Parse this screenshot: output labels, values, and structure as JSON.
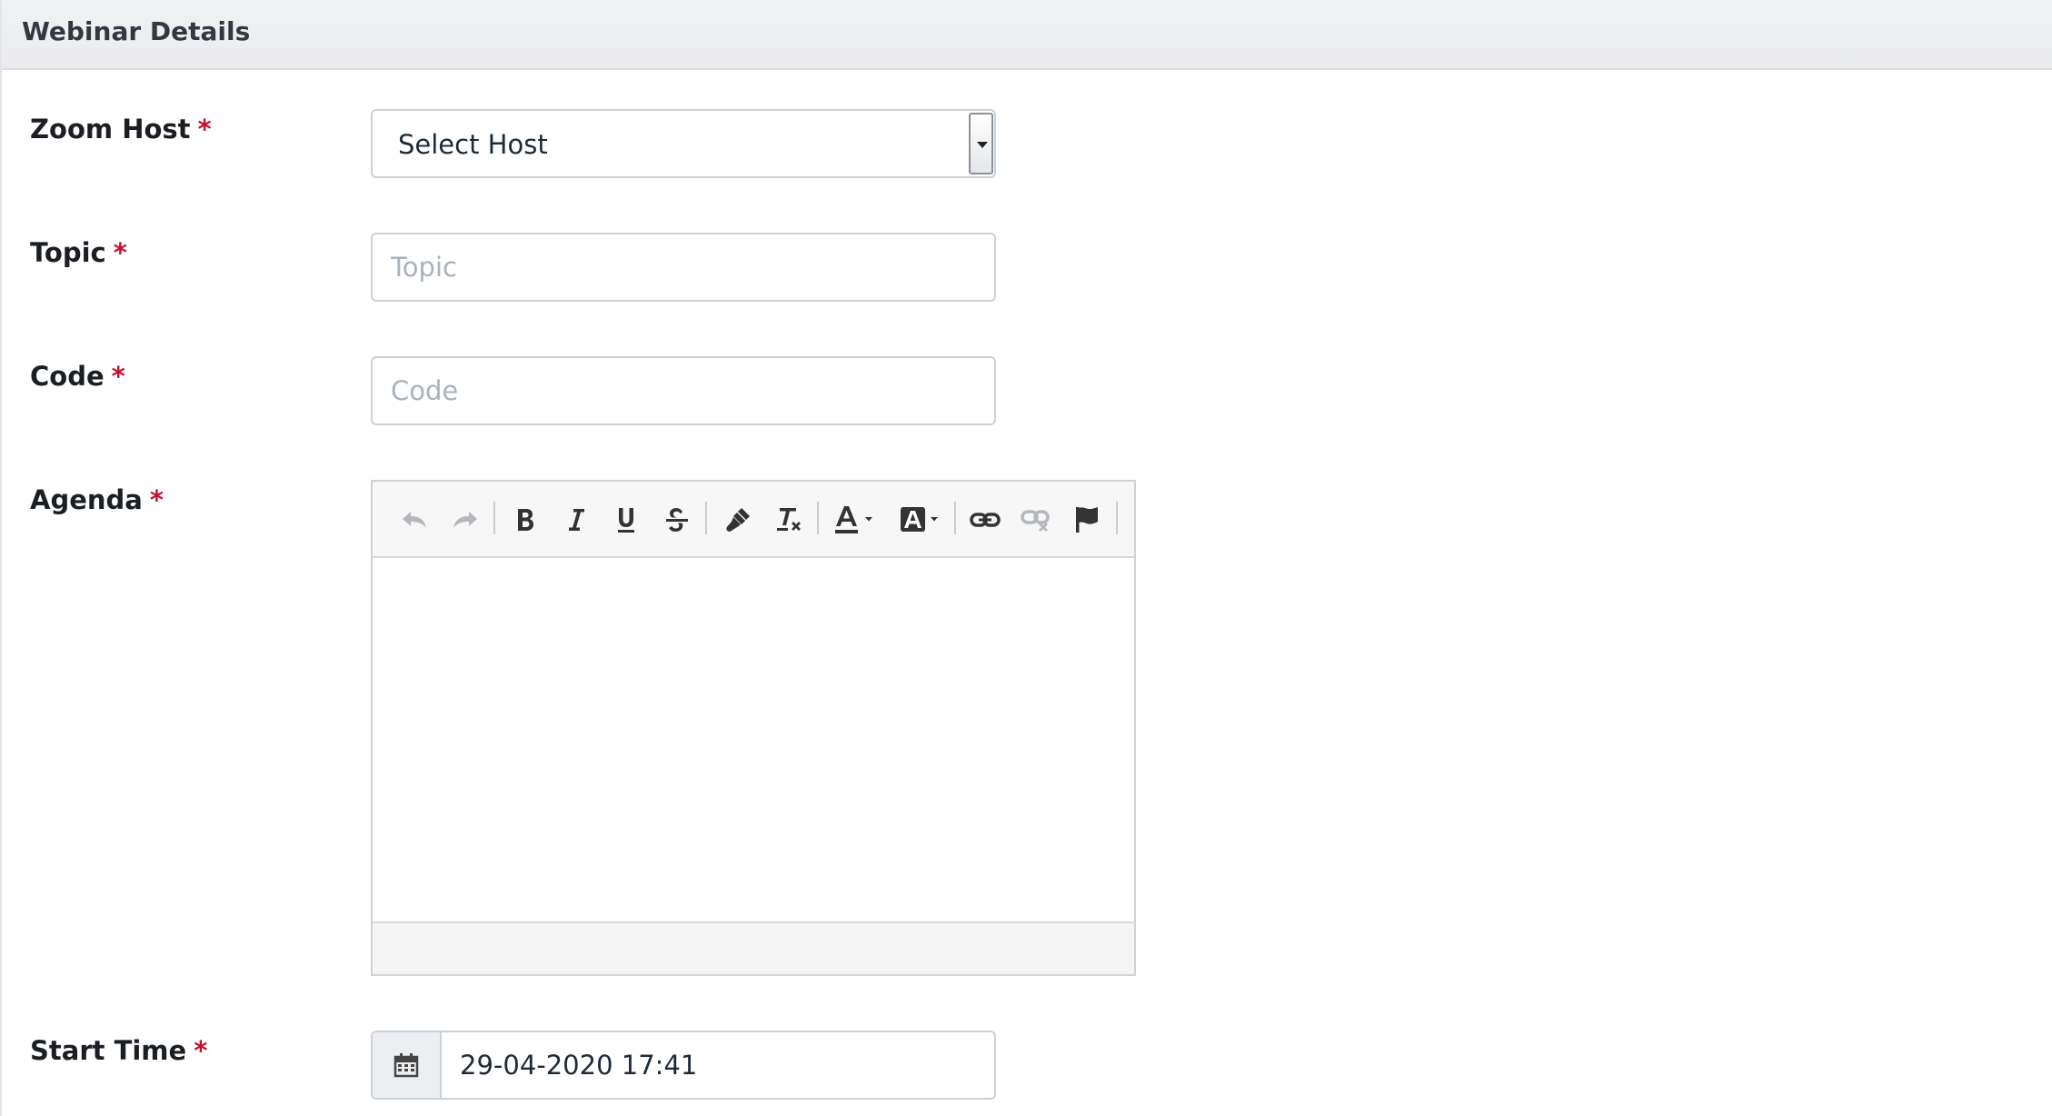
{
  "panel": {
    "title": "Webinar Details"
  },
  "form": {
    "required_marker": "*",
    "zoom_host": {
      "label": "Zoom Host",
      "selected": "Select Host"
    },
    "topic": {
      "label": "Topic",
      "placeholder": "Topic",
      "value": ""
    },
    "code": {
      "label": "Code",
      "placeholder": "Code",
      "value": ""
    },
    "agenda": {
      "label": "Agenda",
      "toolbar": [
        "undo-icon",
        "redo-icon",
        "bold-icon",
        "italic-icon",
        "underline-icon",
        "strikethrough-icon",
        "format-painter-icon",
        "clear-formatting-icon",
        "text-color-icon",
        "background-color-icon",
        "link-icon",
        "unlink-icon",
        "anchor-flag-icon"
      ]
    },
    "start_time": {
      "label": "Start Time",
      "value": "29-04-2020 17:41"
    }
  },
  "colors": {
    "required": "#c8102e",
    "placeholder": "#a9b2bd",
    "border": "#cbd1d8",
    "header_bg": "#eeeff1"
  }
}
